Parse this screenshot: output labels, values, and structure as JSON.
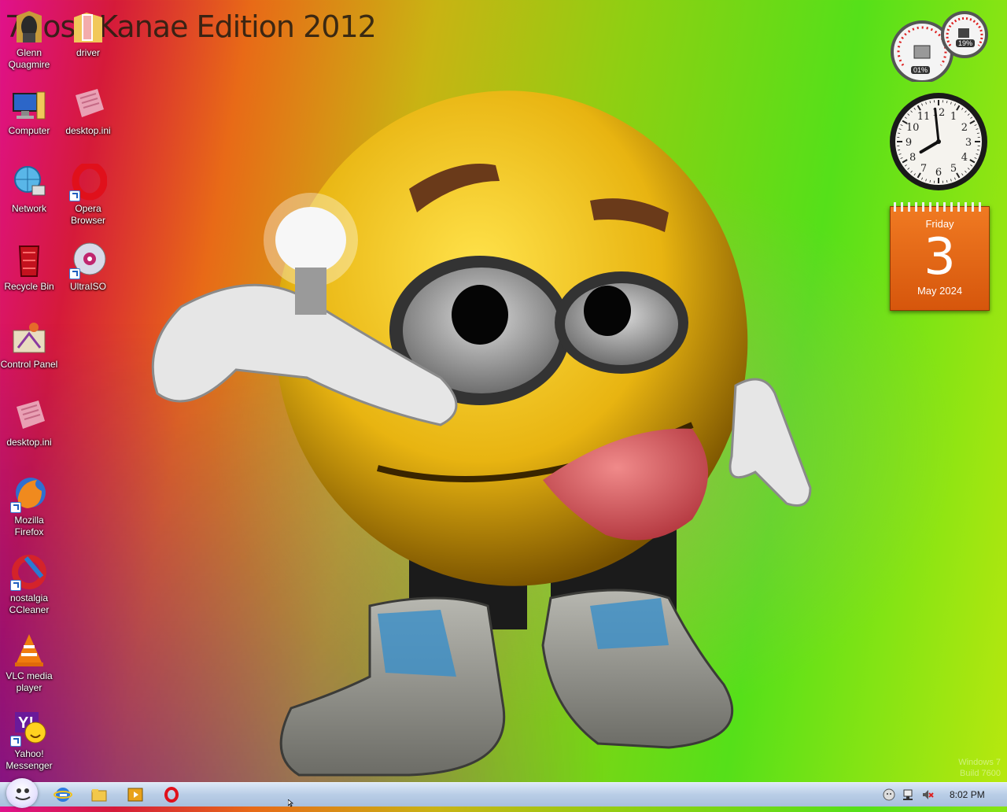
{
  "wallpaper": {
    "title": "7Boss Kanae Edition 2012",
    "watermark": [
      "Windows 7",
      "Build 7600"
    ]
  },
  "desktop_icons": [
    {
      "label": "Glenn Quagmire",
      "icon": "folder-character-icon"
    },
    {
      "label": "driver",
      "icon": "folder-icon"
    },
    {
      "label": "Computer",
      "icon": "computer-icon"
    },
    {
      "label": "desktop.ini",
      "icon": "settings-file-icon"
    },
    {
      "label": "Network",
      "icon": "network-icon"
    },
    {
      "label": "Opera Browser",
      "icon": "opera-icon"
    },
    {
      "label": "Recycle Bin",
      "icon": "recycle-bin-icon"
    },
    {
      "label": "UltraISO",
      "icon": "disc-icon"
    },
    {
      "label": "Control Panel",
      "icon": "control-panel-icon"
    },
    {
      "label": "desktop.ini",
      "icon": "settings-file-icon"
    },
    {
      "label": "Mozilla Firefox",
      "icon": "firefox-icon"
    },
    {
      "label": "nostalgia CCleaner",
      "icon": "ccleaner-icon"
    },
    {
      "label": "VLC media player",
      "icon": "vlc-icon"
    },
    {
      "label": "Yahoo! Messenger",
      "icon": "yahoo-messenger-icon"
    }
  ],
  "gadgets": {
    "cpu_meter": {
      "cpu": "01%",
      "memory": "19%"
    },
    "clock": {
      "hour": 7,
      "minute": 59,
      "numbers": [
        "12",
        "1",
        "2",
        "3",
        "4",
        "5",
        "6",
        "7",
        "8",
        "9",
        "10",
        "11"
      ]
    },
    "calendar": {
      "weekday": "Friday",
      "day": "3",
      "month_year": "May 2024"
    }
  },
  "taskbar": {
    "pinned": [
      "internet-explorer-icon",
      "explorer-folder-icon",
      "media-player-icon",
      "opera-icon"
    ],
    "tray": [
      "messenger-tray-icon",
      "network-tray-icon",
      "volume-muted-icon"
    ],
    "time": "8:02 PM"
  }
}
